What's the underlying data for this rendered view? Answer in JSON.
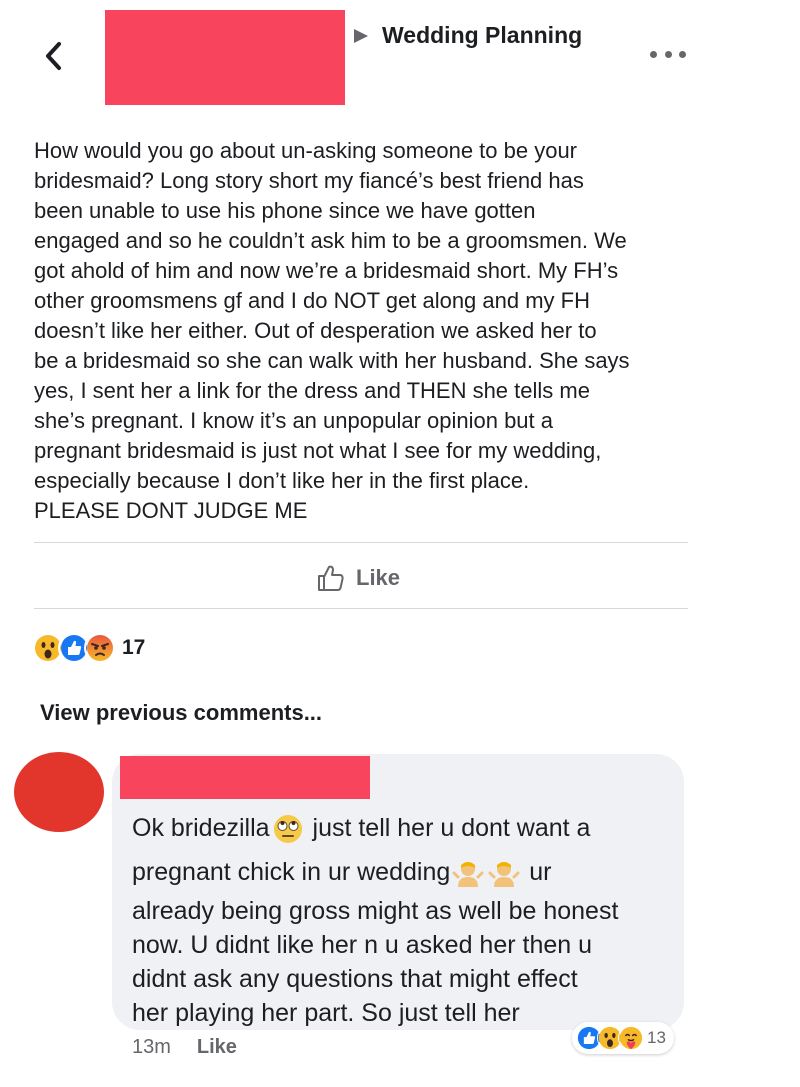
{
  "header": {
    "group_name": "Wedding Planning",
    "icons": {
      "back": "chevron-left-icon",
      "breadcrumb": "triangle-right-icon",
      "more": "more-dots-icon"
    }
  },
  "post": {
    "body": "How would you go about un-asking someone to be your\nbridesmaid? Long story short my fiancé’s best friend has\nbeen unable to use his phone since we have gotten\nengaged and so he couldn’t ask him to be a groomsmen. We\ngot ahold of him and now we’re a bridesmaid short. My FH’s\nother groomsmens gf and I do NOT get along and my FH\ndoesn’t like her either. Out of desperation we asked her to\nbe a bridesmaid so she can walk with her husband. She says\nyes, I sent her a link for the dress and THEN she tells me\nshe’s pregnant. I know it’s an unpopular opinion but a\npregnant bridesmaid is just not what I see for my wedding,\nespecially because I don’t like her in the first place.",
    "closing": "PLEASE DONT JUDGE ME",
    "like_label": "Like",
    "reactions": [
      "wow",
      "like",
      "angry"
    ],
    "reaction_count": "17"
  },
  "comments": {
    "view_previous_label": "View previous comments...",
    "items": [
      {
        "line1_a": "Ok bridezilla",
        "line1_emoji": "eye-roll-emoji",
        "line1_b": " just tell her u dont want a",
        "line2_a": "pregnant chick in ur wedding",
        "line2_emoji": "person-shrugging-emoji",
        "line2_b": " ur",
        "line3": "already being gross might as well be honest",
        "line4": "now. U didnt like her n u asked her then u",
        "line5": "didnt ask any questions that might effect",
        "line6": "her playing her part. So just tell her",
        "time": "13m",
        "like_label": "Like",
        "reactions": [
          "like",
          "wow",
          "care"
        ],
        "reaction_count": "13"
      }
    ]
  },
  "colors": {
    "redaction": "#f9445e",
    "avatar": "#e2352b",
    "bubble": "#eff1f4",
    "like_blue": "#1877f2",
    "secondary_text": "#65676b"
  }
}
